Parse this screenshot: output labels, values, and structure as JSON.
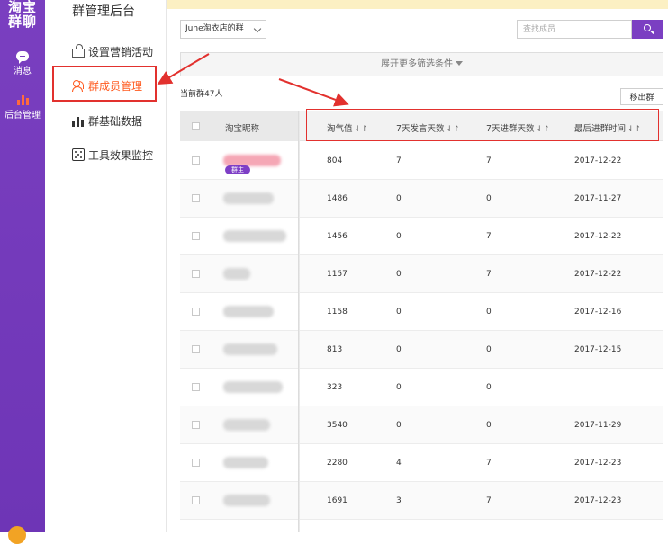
{
  "app": {
    "brand_line1": "淘宝",
    "brand_line2": "群聊"
  },
  "rail": {
    "items": [
      {
        "label": "消息",
        "icon": "message-bubble-icon"
      },
      {
        "label": "后台管理",
        "icon": "bar-chart-icon"
      }
    ]
  },
  "sidebar": {
    "title": "群管理后台",
    "items": [
      {
        "label": "设置营销活动",
        "icon": "shopping-bag-icon",
        "active": false
      },
      {
        "label": "群成员管理",
        "icon": "users-icon",
        "active": true
      },
      {
        "label": "群基础数据",
        "icon": "bar-chart-icon",
        "active": false
      },
      {
        "label": "工具效果监控",
        "icon": "dice-icon",
        "active": false
      }
    ]
  },
  "filters": {
    "group_select_value": "June淘衣店的群",
    "search_placeholder": "查找成员",
    "expand_label": "展开更多筛选条件"
  },
  "summary": {
    "member_count_text": "当前群47人",
    "remove_button_label": "移出群"
  },
  "table": {
    "columns": [
      "淘宝昵称",
      "淘气值",
      "7天发言天数",
      "7天进群天数",
      "最后进群时间"
    ],
    "sort_icon": "⇃↾",
    "owner_badge": "群主",
    "rows": [
      {
        "taoqi": "804",
        "speak7": "7",
        "join7": "7",
        "last": "2017-12-22"
      },
      {
        "taoqi": "1486",
        "speak7": "0",
        "join7": "0",
        "last": "2017-11-27"
      },
      {
        "taoqi": "1456",
        "speak7": "0",
        "join7": "7",
        "last": "2017-12-22"
      },
      {
        "taoqi": "1157",
        "speak7": "0",
        "join7": "7",
        "last": "2017-12-22"
      },
      {
        "taoqi": "1158",
        "speak7": "0",
        "join7": "0",
        "last": "2017-12-16"
      },
      {
        "taoqi": "813",
        "speak7": "0",
        "join7": "0",
        "last": "2017-12-15"
      },
      {
        "taoqi": "323",
        "speak7": "0",
        "join7": "0",
        "last": ""
      },
      {
        "taoqi": "3540",
        "speak7": "0",
        "join7": "0",
        "last": "2017-11-29"
      },
      {
        "taoqi": "2280",
        "speak7": "4",
        "join7": "7",
        "last": "2017-12-23"
      },
      {
        "taoqi": "1691",
        "speak7": "3",
        "join7": "7",
        "last": "2017-12-23"
      }
    ]
  },
  "colors": {
    "brand_purple": "#7a3fc0",
    "active_orange": "#ff5a1f",
    "annotation_red": "#e2312e",
    "notice_yellow": "#fcf0c3"
  }
}
